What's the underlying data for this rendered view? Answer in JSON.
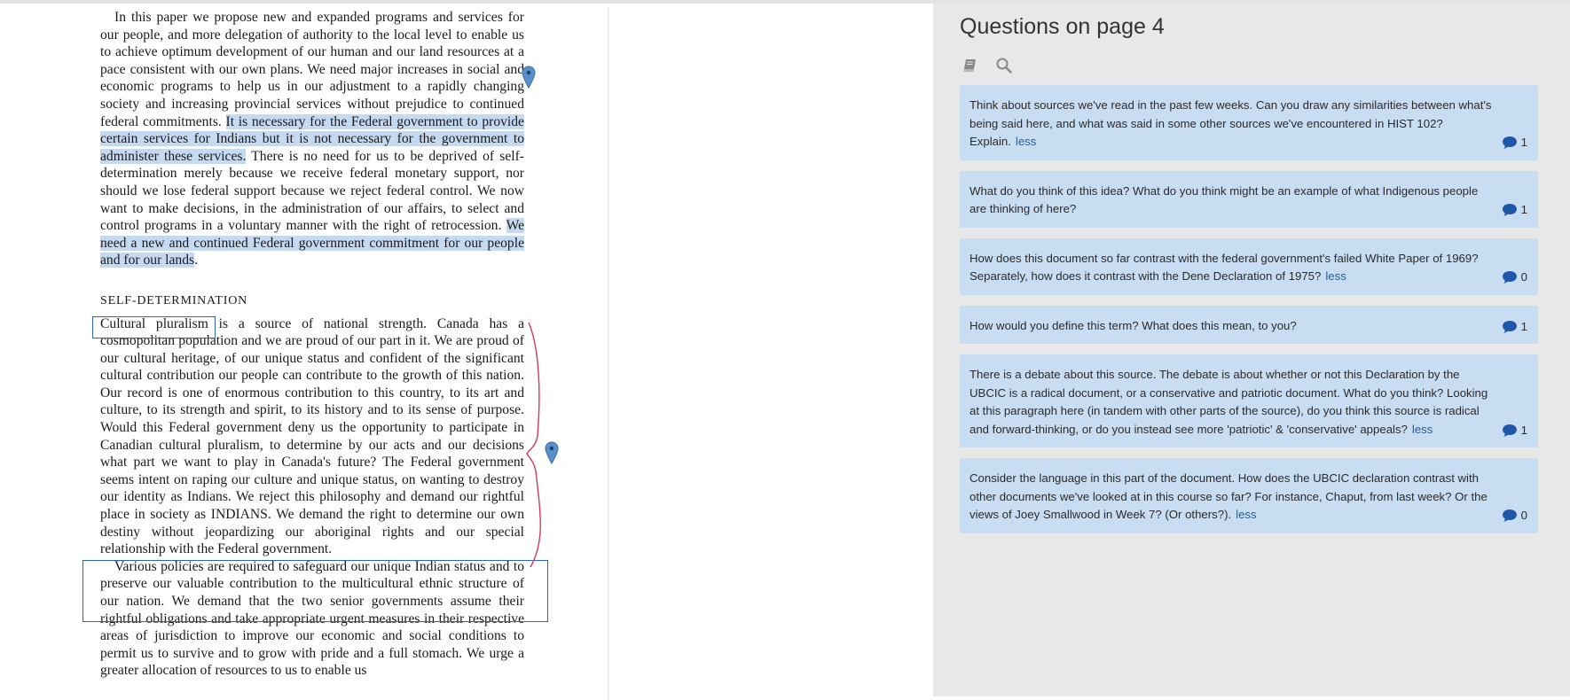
{
  "document": {
    "paragraph1": {
      "part1": "In this paper we propose new and expanded programs and services for our people, and more delegation of authority to the local level to enable us to achieve optimum development of our human and our land resources at a pace consistent with our own plans. We need major increases in social and economic programs to help us in our adjustment to a rapidly changing society and increasing provincial services without prejudice to continued federal commitments. ",
      "highlight1": "It is necessary for the Federal government to provide certain services for Indians but it is not necessary for the government to administer these services.",
      "part2": " There is no need for us to be deprived of self-determination merely because we receive federal monetary support, nor should we lose federal support because we reject federal control. We now want to make decisions, in the administration of our affairs, to select and control programs in a voluntary manner with the right of retrocession. ",
      "highlight2": "We need a new and continued Federal government commitment for our people and for our lands",
      "part3": "."
    },
    "heading": "SELF-DETERMINATION",
    "paragraph2": "Cultural pluralism is a source of national strength. Canada has a cosmopolitan population and we are proud of our part in it. We are proud of our cultural heritage, of our unique status and confident of the significant cultural contribution our people can contribute to the growth of this nation. Our record is one of enormous contribution to this country, to its art and culture, to its strength and spirit, to its history and to its sense of purpose. Would this Federal government deny us the opportunity to participate in Canadian cultural pluralism, to determine by our acts and our decisions what part we want to play in Canada's future? The Federal government seems intent on raping our culture and unique status, on wanting to destroy our identity as Indians. We reject this philosophy and demand our rightful place in society as INDIANS. We demand the right to determine our own destiny without jeopardizing our aboriginal rights and our special relationship with the Federal government.",
    "paragraph3": "Various policies are required to safeguard our unique Indian status and to preserve our valuable contribution to the multicultural ethnic structure of our nation. We demand that the two senior governments assume their rightful obligations and take appropriate urgent measures in their respective areas of jurisdiction to improve our economic and social conditions to permit us to survive and to grow with pride and a full stomach. We urge a greater allocation of resources to us to enable us"
  },
  "panel": {
    "title": "Questions on page 4",
    "accent_color": "#c8dcf2",
    "icons": [
      "book-icon",
      "search-icon"
    ],
    "questions": [
      {
        "text": "Think about sources we've read in the past few weeks. Can you draw any similarities between what's being said here, and what was said in some other sources we've encountered in HIST 102? Explain.",
        "less": "less",
        "count": "1"
      },
      {
        "text": "What do you think of this idea? What do you think might be an example of what Indigenous people are thinking of here?",
        "less": "",
        "count": "1"
      },
      {
        "text": "How does this document so far contrast with the federal government's failed White Paper of 1969? Separately, how does it contrast with the Dene Declaration of 1975?",
        "less": "less",
        "count": "0"
      },
      {
        "text": "How would you define this term? What does this mean, to you?",
        "less": "",
        "count": "1"
      },
      {
        "text": "There is a debate about this source. The debate is about whether or not this Declaration by the UBCIC is a radical document, or a conservative and patriotic document. What do you think? Looking at this paragraph here (in tandem with other parts of the source), do you think this source is radical and forward-thinking, or do you instead see more 'patriotic' & 'conservative' appeals?",
        "less": "less",
        "count": "1"
      },
      {
        "text": "Consider the language in this part of the document. How does the UBCIC declaration contrast with other documents we've looked at in this course so far? For instance, Chaput, from last week? Or the views of Joey Smallwood in Week 7? (Or others?).",
        "less": "less",
        "count": "0"
      }
    ]
  }
}
